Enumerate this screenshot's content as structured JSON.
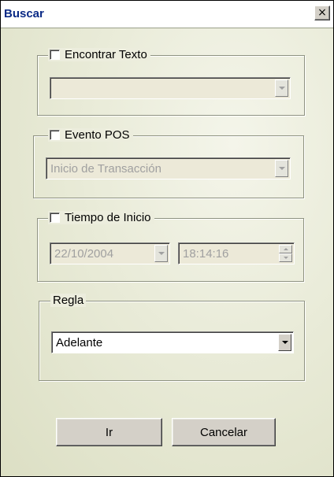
{
  "window": {
    "title": "Buscar",
    "close_glyph": "×"
  },
  "find_text": {
    "label": "Encontrar Texto",
    "checked": false,
    "value": "",
    "enabled": false
  },
  "pos_event": {
    "label": "Evento POS",
    "checked": false,
    "value": "Inicio de Transacción",
    "enabled": false
  },
  "start_time": {
    "label": "Tiempo de Inicio",
    "checked": false,
    "date_value": "22/10/2004",
    "time_value": "18:14:16",
    "enabled": false
  },
  "rule": {
    "label": "Regla",
    "value": "Adelante",
    "enabled": true
  },
  "buttons": {
    "go_label": "Ir",
    "cancel_label": "Cancelar"
  }
}
